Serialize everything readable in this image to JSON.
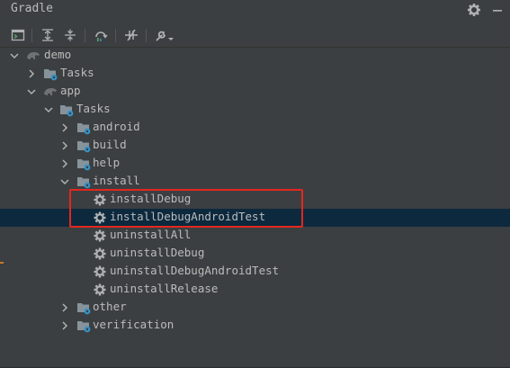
{
  "panel": {
    "title": "Gradle",
    "header_icons": [
      "gear-icon",
      "minimize-icon"
    ]
  },
  "toolbar": {
    "items": [
      "execute-gradle-task-icon",
      "expand-all-icon",
      "collapse-all-icon",
      "refresh-icon",
      "toggle-offline-mode-icon",
      "build-tool-settings-icon"
    ]
  },
  "tree": {
    "demo": "demo",
    "demo_tasks": "Tasks",
    "app": "app",
    "app_tasks": "Tasks",
    "android": "android",
    "build": "build",
    "help": "help",
    "install": "install",
    "installDebug": "installDebug",
    "installDebugAndroidTest": "installDebugAndroidTest",
    "uninstallAll": "uninstallAll",
    "uninstallDebug": "uninstallDebug",
    "uninstallDebugAndroidTest": "uninstallDebugAndroidTest",
    "uninstallRelease": "uninstallRelease",
    "other": "other",
    "verification": "verification"
  },
  "colors": {
    "background": "#3c3f41",
    "selection": "#0d293e",
    "highlight_box": "#e3271f",
    "text": "#bbbbbb",
    "gradle_icon": "#6f7275",
    "gear_badge": "#3592c4"
  }
}
